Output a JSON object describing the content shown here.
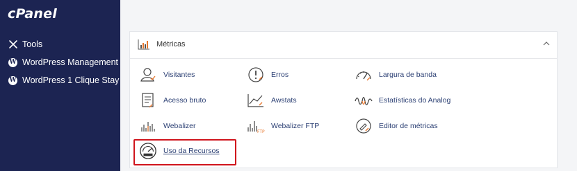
{
  "brand": {
    "logo": "cPanel"
  },
  "sidebar": {
    "items": [
      {
        "label": "Tools",
        "icon": "tools-icon"
      },
      {
        "label": "WordPress Management",
        "icon": "wordpress-icon"
      },
      {
        "label": "WordPress 1 Clique Stay",
        "icon": "wordpress-icon"
      }
    ]
  },
  "panel": {
    "title": "Métricas",
    "collapse_icon": "chevron-up-icon",
    "items": [
      {
        "label": "Visitantes",
        "icon": "visitors-icon"
      },
      {
        "label": "Erros",
        "icon": "errors-icon"
      },
      {
        "label": "Largura de banda",
        "icon": "bandwidth-icon"
      },
      {
        "label": "Acesso bruto",
        "icon": "raw-access-icon"
      },
      {
        "label": "Awstats",
        "icon": "awstats-icon"
      },
      {
        "label": "Estatísticas do Analog",
        "icon": "analog-stats-icon"
      },
      {
        "label": "Webalizer",
        "icon": "webalizer-icon"
      },
      {
        "label": "Webalizer FTP",
        "icon": "webalizer-ftp-icon"
      },
      {
        "label": "Editor de métricas",
        "icon": "metrics-editor-icon"
      },
      {
        "label": "Uso da Recursos",
        "icon": "resource-usage-icon"
      }
    ]
  },
  "colors": {
    "sidebar_bg": "#1c2452",
    "highlight_border": "#d0141c",
    "link_text": "#2b3f73",
    "accent_orange": "#e8772e"
  }
}
